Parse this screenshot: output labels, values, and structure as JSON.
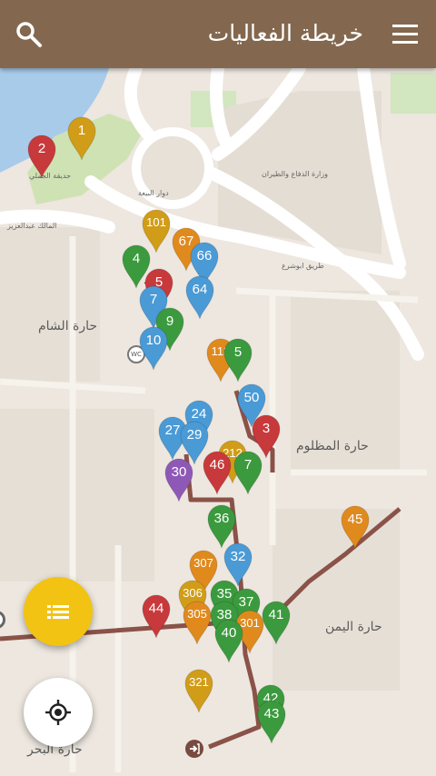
{
  "header": {
    "title": "خريطة الفعاليات",
    "search_icon": "search-icon",
    "menu_icon": "menu-icon"
  },
  "colors": {
    "appbar": "#83684f",
    "pin_red": "#c8393b",
    "pin_gold": "#d19d18",
    "pin_orange": "#e08a1d",
    "pin_green": "#3b9a3e",
    "pin_blue": "#4a9ad6",
    "pin_purple": "#8e59b6",
    "pin_teal": "#2a9a94",
    "fab_list": "#f3c313",
    "route": "#7a4a40"
  },
  "map_labels": {
    "park": "حديقة الجملي",
    "roundabout": "دوار البيعة",
    "ministry": "وزارة الدفاع والطيران",
    "street": "المالك عبدالعزيز",
    "street2": "طريق ابوشرع",
    "harat_alsham": "حارة الشام",
    "harat_almadhloum": "حارة المظلوم",
    "harat_alyemen": "حارة اليمن",
    "harat_albahr": "حارة البحر",
    "wc": "WC"
  },
  "pins": [
    {
      "label": "1",
      "color": "gold"
    },
    {
      "label": "2",
      "color": "red"
    },
    {
      "label": "101",
      "color": "gold"
    },
    {
      "label": "67",
      "color": "orange"
    },
    {
      "label": "66",
      "color": "blue"
    },
    {
      "label": "4",
      "color": "green"
    },
    {
      "label": "5",
      "color": "red"
    },
    {
      "label": "64",
      "color": "blue"
    },
    {
      "label": "7",
      "color": "blue"
    },
    {
      "label": "9",
      "color": "green"
    },
    {
      "label": "10",
      "color": "blue"
    },
    {
      "label": "113",
      "color": "orange"
    },
    {
      "label": "5",
      "color": "green"
    },
    {
      "label": "50",
      "color": "blue"
    },
    {
      "label": "3",
      "color": "red"
    },
    {
      "label": "24",
      "color": "blue"
    },
    {
      "label": "27",
      "color": "blue"
    },
    {
      "label": "29",
      "color": "blue"
    },
    {
      "label": "212",
      "color": "gold"
    },
    {
      "label": "46",
      "color": "red"
    },
    {
      "label": "7",
      "color": "green"
    },
    {
      "label": "30",
      "color": "purple"
    },
    {
      "label": "36",
      "color": "green"
    },
    {
      "label": "45",
      "color": "orange"
    },
    {
      "label": "307",
      "color": "orange"
    },
    {
      "label": "32",
      "color": "blue"
    },
    {
      "label": "306",
      "color": "gold"
    },
    {
      "label": "35",
      "color": "green"
    },
    {
      "label": "37",
      "color": "green"
    },
    {
      "label": "44",
      "color": "red"
    },
    {
      "label": "305",
      "color": "orange"
    },
    {
      "label": "38",
      "color": "green"
    },
    {
      "label": "301",
      "color": "orange"
    },
    {
      "label": "41",
      "color": "green"
    },
    {
      "label": "40",
      "color": "green"
    },
    {
      "label": "321",
      "color": "gold"
    },
    {
      "label": "42",
      "color": "green"
    },
    {
      "label": "43",
      "color": "green"
    }
  ],
  "fabs": {
    "list_icon": "list-icon",
    "locate_icon": "my-location-icon"
  }
}
